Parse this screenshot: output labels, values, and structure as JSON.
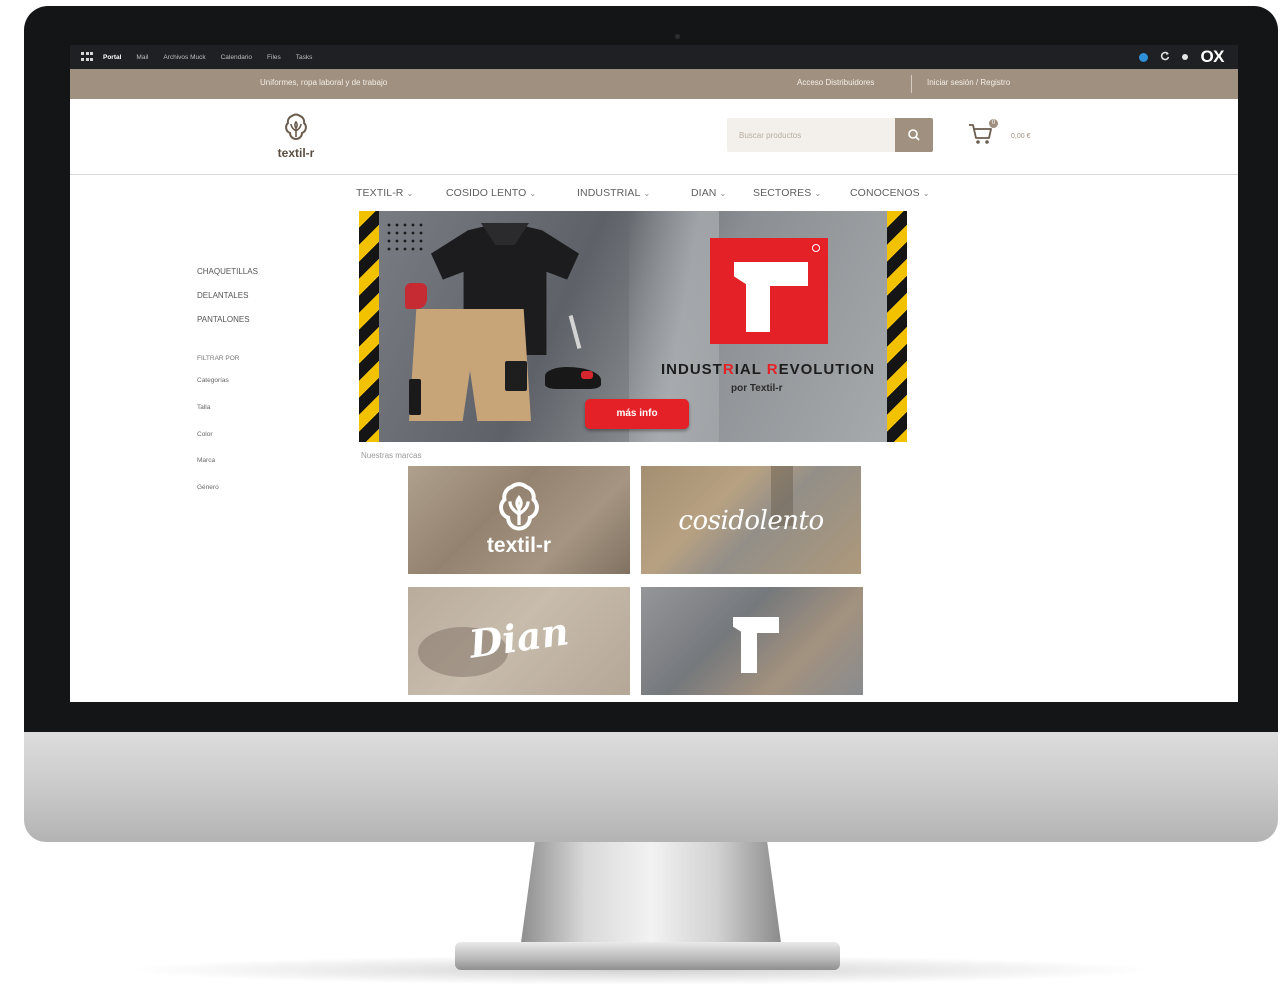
{
  "system_bar": {
    "links": [
      "Portal",
      "Mail",
      "Archivos Muck",
      "Calendario",
      "Files",
      "Tasks"
    ],
    "active_index": 0,
    "brand": "OX"
  },
  "topbar": {
    "tagline": "Uniformes, ropa laboral y de trabajo",
    "distributors": "Acceso Distribuidores",
    "login": "Iniciar sesión / Registro"
  },
  "header": {
    "logo_text": "textil-r",
    "search_placeholder": "Buscar productos",
    "cart_count": "0",
    "cart_total": "0,00 €"
  },
  "nav": {
    "items": [
      "TEXTIL-R",
      "COSIDO LENTO",
      "INDUSTRIAL",
      "DIAN",
      "SECTORES",
      "CONOCENOS"
    ]
  },
  "sidebar": {
    "categories": [
      "CHAQUETILLAS",
      "DELANTALES",
      "PANTALONES"
    ],
    "filter_title": "FILTRAR POR",
    "filters": [
      "Categorías",
      "Talla",
      "Color",
      "Marca",
      "Género"
    ]
  },
  "hero": {
    "title_part1": "INDUST",
    "title_accent1": "R",
    "title_part2": "IAL ",
    "title_accent2": "R",
    "title_part3": "EVOLUTION",
    "subtitle": "por Textil-r",
    "cta": "más info"
  },
  "brands": {
    "heading": "Nuestras marcas",
    "tiles": [
      {
        "label": "textil-r"
      },
      {
        "label": "cosidolento"
      },
      {
        "label": "Dian"
      },
      {
        "label": ""
      }
    ]
  },
  "colors": {
    "brand_brown": "#a0907f",
    "accent_red": "#e42127",
    "hazard_yellow": "#f2c200"
  }
}
